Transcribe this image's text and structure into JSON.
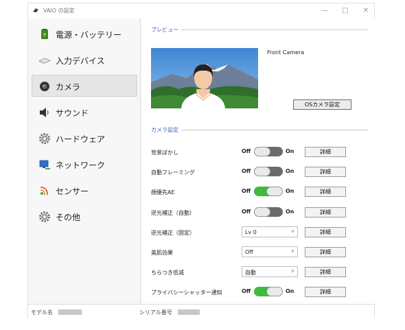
{
  "window": {
    "title": "VAIO の設定"
  },
  "titlebar": {
    "minimize_icon": "minimize-icon",
    "maximize_icon": "maximize-icon",
    "close_icon": "close-icon"
  },
  "sidebar": {
    "items": [
      {
        "label": "電源・バッテリー",
        "icon": "battery-icon",
        "active": false
      },
      {
        "label": "入力デバイス",
        "icon": "keyboard-icon",
        "active": false
      },
      {
        "label": "カメラ",
        "icon": "camera-icon",
        "active": true
      },
      {
        "label": "サウンド",
        "icon": "speaker-icon",
        "active": false
      },
      {
        "label": "ハードウェア",
        "icon": "gear-icon",
        "active": false
      },
      {
        "label": "ネットワーク",
        "icon": "network-icon",
        "active": false
      },
      {
        "label": "センサー",
        "icon": "sensor-icon",
        "active": false
      },
      {
        "label": "その他",
        "icon": "gear-icon",
        "active": false
      }
    ]
  },
  "preview": {
    "section_title": "プレビュー",
    "camera_name": "Front Camera",
    "os_camera_button": "OSカメラ設定"
  },
  "camera_settings": {
    "section_title": "カメラ設定",
    "off_label": "Off",
    "on_label": "On",
    "detail_label": "詳細",
    "rows": [
      {
        "label": "背景ぼかし",
        "type": "toggle",
        "on": false
      },
      {
        "label": "自動フレーミング",
        "type": "toggle",
        "on": false
      },
      {
        "label": "顔優先AE",
        "type": "toggle",
        "on": true
      },
      {
        "label": "逆光補正（自動）",
        "type": "toggle",
        "on": false
      },
      {
        "label": "逆光補正（固定）",
        "type": "select",
        "value": "Lv 0"
      },
      {
        "label": "美肌効果",
        "type": "select",
        "value": "Off"
      },
      {
        "label": "ちらつき低減",
        "type": "select",
        "value": "自動"
      },
      {
        "label": "プライバシーシャッター通知",
        "type": "toggle",
        "on": true
      }
    ]
  },
  "statusbar": {
    "model_label": "モデル名",
    "serial_label": "シリアル番号"
  },
  "colors": {
    "accent": "#3a67b8",
    "toggle_on": "#3dbb3d",
    "toggle_off": "#6b6b6b"
  }
}
